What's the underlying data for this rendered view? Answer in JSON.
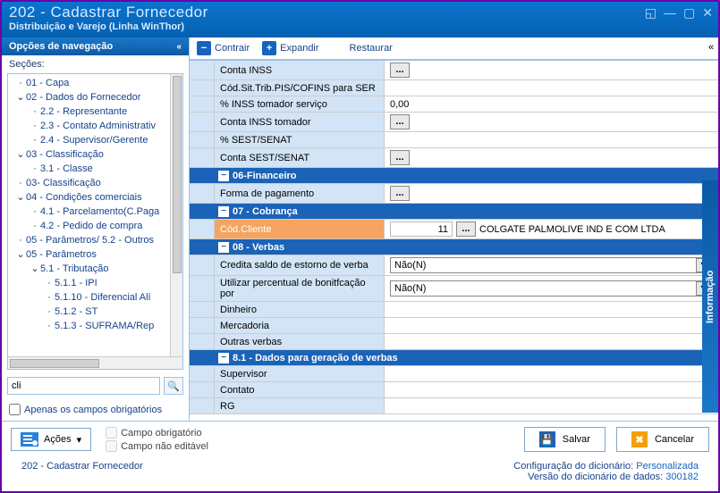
{
  "window": {
    "title": "202 - Cadastrar  Fornecedor",
    "subtitle": "Distribuição e Varejo (Linha WinThor)"
  },
  "nav": {
    "header": "Opções de navegação",
    "sections_label": "Seções:",
    "search_value": "cli",
    "only_required_label": "Apenas os campos obrigatórios",
    "tree": [
      {
        "lvl": 1,
        "exp": "",
        "text": "01 - Capa"
      },
      {
        "lvl": 1,
        "exp": "v",
        "text": "02 - Dados do Fornecedor"
      },
      {
        "lvl": 2,
        "exp": "",
        "text": "2.2 - Representante"
      },
      {
        "lvl": 2,
        "exp": "",
        "text": "2.3 - Contato Administrativ"
      },
      {
        "lvl": 2,
        "exp": "",
        "text": "2.4 - Supervisor/Gerente"
      },
      {
        "lvl": 1,
        "exp": "v",
        "text": "03 - Classificação"
      },
      {
        "lvl": 2,
        "exp": "",
        "text": "3.1 - Classe"
      },
      {
        "lvl": 1,
        "exp": "",
        "text": "03- Classificação"
      },
      {
        "lvl": 1,
        "exp": "v",
        "text": "04 - Condições comerciais"
      },
      {
        "lvl": 2,
        "exp": "",
        "text": "4.1 - Parcelamento(C.Paga"
      },
      {
        "lvl": 2,
        "exp": "",
        "text": "4.2 - Pedido de compra"
      },
      {
        "lvl": 1,
        "exp": "",
        "text": "05 - Parâmetros/ 5.2 - Outros"
      },
      {
        "lvl": 1,
        "exp": "v",
        "text": "05 - Parâmetros"
      },
      {
        "lvl": 2,
        "exp": "v",
        "text": "5.1 - Tributação"
      },
      {
        "lvl": 3,
        "exp": "",
        "text": "5.1.1 - IPI"
      },
      {
        "lvl": 3,
        "exp": "",
        "text": "5.1.10 - Diferencial Alí"
      },
      {
        "lvl": 3,
        "exp": "",
        "text": "5.1.2 - ST"
      },
      {
        "lvl": 3,
        "exp": "",
        "text": "5.1.3 - SUFRAMA/Rep"
      }
    ]
  },
  "toolbar": {
    "contrair": "Contrair",
    "expandir": "Expandir",
    "restaurar": "Restaurar"
  },
  "grid": {
    "rows": [
      {
        "type": "field",
        "label": "Conta INSS",
        "lookup": true
      },
      {
        "type": "field",
        "label": "Cód.Sit.Trib.PIS/COFINS para SER",
        "lookup": false
      },
      {
        "type": "field",
        "label": "% INSS tomador serviço",
        "value": "0,00"
      },
      {
        "type": "field",
        "label": "Conta INSS tomador",
        "lookup": true
      },
      {
        "type": "field",
        "label": "% SEST/SENAT"
      },
      {
        "type": "field",
        "label": "Conta SEST/SENAT",
        "lookup": true
      },
      {
        "type": "section",
        "label": "06-Financeiro"
      },
      {
        "type": "field",
        "label": "Forma de pagamento",
        "lookup": true
      },
      {
        "type": "section",
        "label": "07 - Cobrança"
      },
      {
        "type": "field",
        "label": "Cód.Cliente",
        "highlight": true,
        "inputval": "11",
        "lookup": true,
        "aftertext": "COLGATE PALMOLIVE IND E COM LTDA"
      },
      {
        "type": "section",
        "label": "08 - Verbas"
      },
      {
        "type": "field",
        "label": "Credita saldo de estorno de verba",
        "dd": "Não(N)"
      },
      {
        "type": "field",
        "label": "Utilizar percentual de bonitfcação por",
        "dd": "Não(N)"
      },
      {
        "type": "field",
        "label": "Dinheiro"
      },
      {
        "type": "field",
        "label": "Mercadoria"
      },
      {
        "type": "field",
        "label": "Outras verbas"
      },
      {
        "type": "section",
        "label": "8.1 - Dados para geração de verbas"
      },
      {
        "type": "field",
        "label": "Supervisor"
      },
      {
        "type": "field",
        "label": "Contato"
      },
      {
        "type": "field",
        "label": "RG"
      }
    ]
  },
  "footer": {
    "acoes": "Ações",
    "legend_required": "Campo obrigatório",
    "legend_readonly": "Campo não editável",
    "salvar": "Salvar",
    "cancelar": "Cancelar"
  },
  "status": {
    "left": "202 - Cadastrar  Fornecedor",
    "config_label": "Configuração do dicionário: ",
    "config_value": "Personalizada",
    "version_label": "Versão do dicionário de dados: ",
    "version_value": "300182"
  },
  "info_tab": "Informação"
}
